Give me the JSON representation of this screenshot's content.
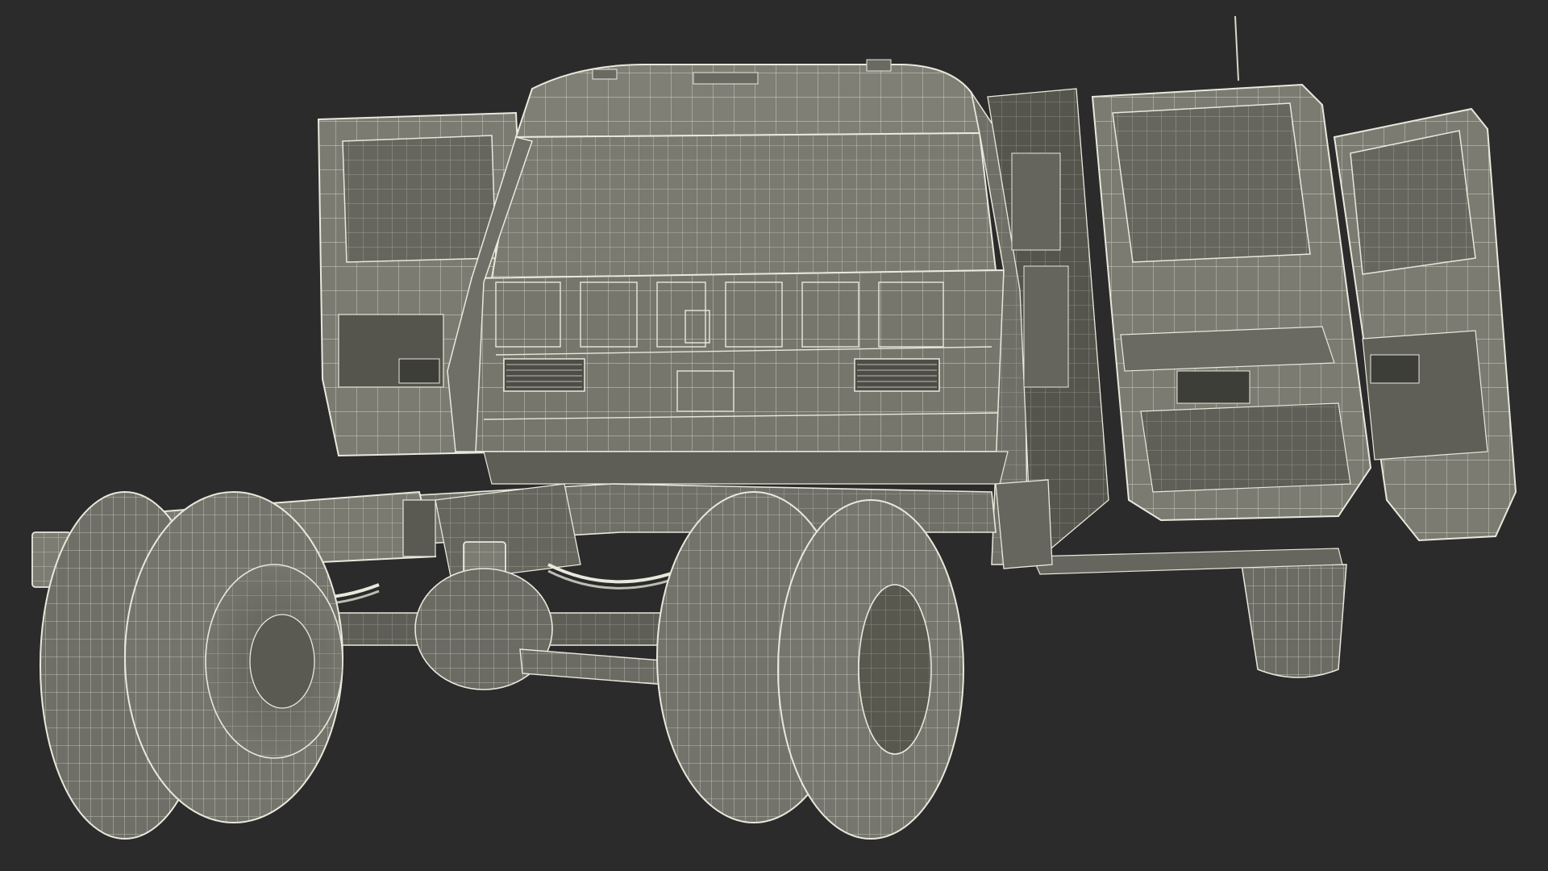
{
  "scene": {
    "background": "#2b2b2b",
    "subject": "truck-chassis-cab-wireframe",
    "colors": {
      "body_fill": "#7b7b72",
      "body_dark": "#66665e",
      "body_shadow": "#55554e",
      "tire_fill": "#707069",
      "wire": "#e8e8dc",
      "wire_dim": "#bdbdb2",
      "cavity": "#4d4d47"
    }
  }
}
